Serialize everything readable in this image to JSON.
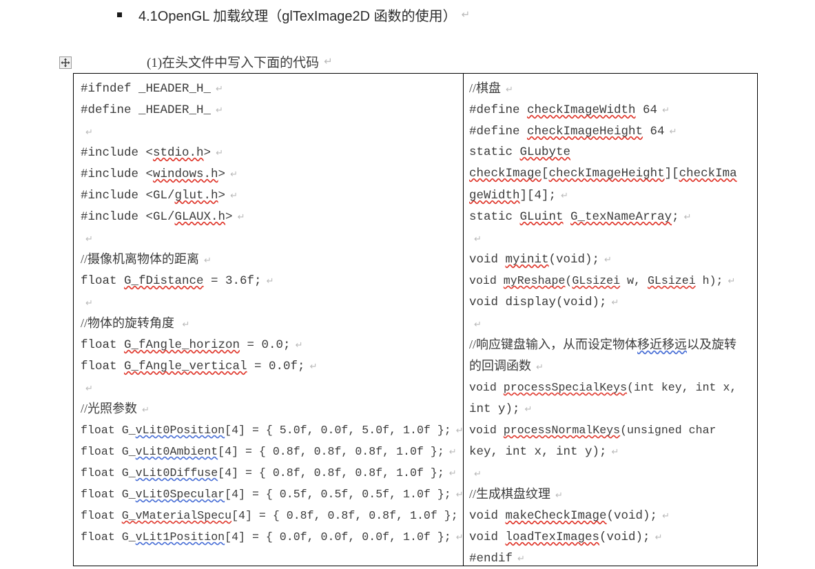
{
  "document": {
    "heading": {
      "bullet": "square-bullet",
      "text": "4.1OpenGL 加载纹理（glTexImage2D 函数的使用）",
      "pilcrow": "↵"
    },
    "caption": {
      "text": "(1)在头文件中写入下面的代码",
      "pilcrow": "↵"
    },
    "table_handle_icon": "table-move-handle-icon",
    "pilcrow_glyph": "↵",
    "colors": {
      "text": "#3b3b3b",
      "spelling_underline": "#e03a2f",
      "grammar_underline": "#4a70d6",
      "pilcrow": "#b9b9b9",
      "table_border": "#000000"
    },
    "table": {
      "columns": [
        {
          "name": "left-code-column",
          "lines": [
            {
              "id": "l1",
              "text": "#ifndef _HEADER_H_",
              "kind": "mono"
            },
            {
              "id": "l2",
              "text": "#define _HEADER_H_",
              "kind": "mono"
            },
            {
              "id": "l3",
              "text": "",
              "kind": "blank"
            },
            {
              "id": "l4",
              "text": "#include <stdio.h>",
              "kind": "mono"
            },
            {
              "id": "l5",
              "text": "#include <windows.h>",
              "kind": "mono"
            },
            {
              "id": "l6",
              "text": "#include <GL/glut.h>",
              "kind": "mono"
            },
            {
              "id": "l7",
              "text": "#include <GL/GLAUX.h>",
              "kind": "mono"
            },
            {
              "id": "l8",
              "text": "",
              "kind": "blank"
            },
            {
              "id": "l9",
              "text": "//摄像机离物体的距离",
              "kind": "cjk"
            },
            {
              "id": "l10",
              "text": "float G_fDistance = 3.6f;",
              "kind": "mono"
            },
            {
              "id": "l11",
              "text": "",
              "kind": "blank"
            },
            {
              "id": "l12",
              "text": "//物体的旋转角度 ",
              "kind": "cjk"
            },
            {
              "id": "l13",
              "text": "float G_fAngle_horizon = 0.0;",
              "kind": "mono"
            },
            {
              "id": "l14",
              "text": "float G_fAngle_vertical = 0.0f;",
              "kind": "mono"
            },
            {
              "id": "l15",
              "text": "",
              "kind": "blank"
            },
            {
              "id": "l16",
              "text": "//光照参数",
              "kind": "cjk"
            },
            {
              "id": "l17",
              "text": "float G_vLit0Position[4] = { 5.0f, 0.0f, 5.0f, 1.0f };",
              "kind": "mono"
            },
            {
              "id": "l18",
              "text": "float G_vLit0Ambient[4] = { 0.8f, 0.8f, 0.8f, 1.0f };",
              "kind": "mono"
            },
            {
              "id": "l19",
              "text": "float G_vLit0Diffuse[4] = { 0.8f, 0.8f, 0.8f, 1.0f };",
              "kind": "mono"
            },
            {
              "id": "l20",
              "text": "float G_vLit0Specular[4] = { 0.5f, 0.5f, 0.5f, 1.0f };",
              "kind": "mono"
            },
            {
              "id": "l21",
              "text": "float G_vMaterialSpecu[4] = { 0.8f, 0.8f, 0.8f, 1.0f };",
              "kind": "mono"
            },
            {
              "id": "l22",
              "text": "float G_vLit1Position[4] = { 0.0f, 0.0f, 0.0f, 1.0f };",
              "kind": "mono"
            }
          ]
        },
        {
          "name": "right-code-column",
          "lines": [
            {
              "id": "r1",
              "text": "//棋盘",
              "kind": "cjk"
            },
            {
              "id": "r2",
              "text": "#define checkImageWidth 64",
              "kind": "mono"
            },
            {
              "id": "r3",
              "text": "#define checkImageHeight 64",
              "kind": "mono"
            },
            {
              "id": "r4",
              "text": "static GLubyte",
              "kind": "mono"
            },
            {
              "id": "r5",
              "text": "checkImage[checkImageHeight][checkIma",
              "kind": "mono"
            },
            {
              "id": "r6",
              "text": "geWidth][4];",
              "kind": "mono"
            },
            {
              "id": "r7",
              "text": "static GLuint G_texNameArray;",
              "kind": "mono"
            },
            {
              "id": "r8",
              "text": "",
              "kind": "blank"
            },
            {
              "id": "r9",
              "text": "void myinit(void);",
              "kind": "mono"
            },
            {
              "id": "r10",
              "text": "void myReshape(GLsizei w, GLsizei h);",
              "kind": "mono"
            },
            {
              "id": "r11",
              "text": "void display(void);",
              "kind": "mono"
            },
            {
              "id": "r12",
              "text": "",
              "kind": "blank"
            },
            {
              "id": "r13",
              "text": "//响应键盘输入，从而设定物体移近移远以及旋转",
              "kind": "cjk"
            },
            {
              "id": "r14",
              "text": "的回调函数",
              "kind": "cjk"
            },
            {
              "id": "r15",
              "text": "void processSpecialKeys(int key, int x,",
              "kind": "mono"
            },
            {
              "id": "r16",
              "text": "int y);",
              "kind": "mono"
            },
            {
              "id": "r17",
              "text": "void processNormalKeys(unsigned char",
              "kind": "mono"
            },
            {
              "id": "r18",
              "text": "key, int x, int y);",
              "kind": "mono"
            },
            {
              "id": "r19",
              "text": "",
              "kind": "blank"
            },
            {
              "id": "r20",
              "text": "//生成棋盘纹理",
              "kind": "cjk"
            },
            {
              "id": "r21",
              "text": "void makeCheckImage(void);",
              "kind": "mono"
            },
            {
              "id": "r22",
              "text": "void loadTexImages(void);",
              "kind": "mono"
            },
            {
              "id": "r23",
              "text": "#endif",
              "kind": "mono"
            }
          ]
        }
      ]
    }
  }
}
